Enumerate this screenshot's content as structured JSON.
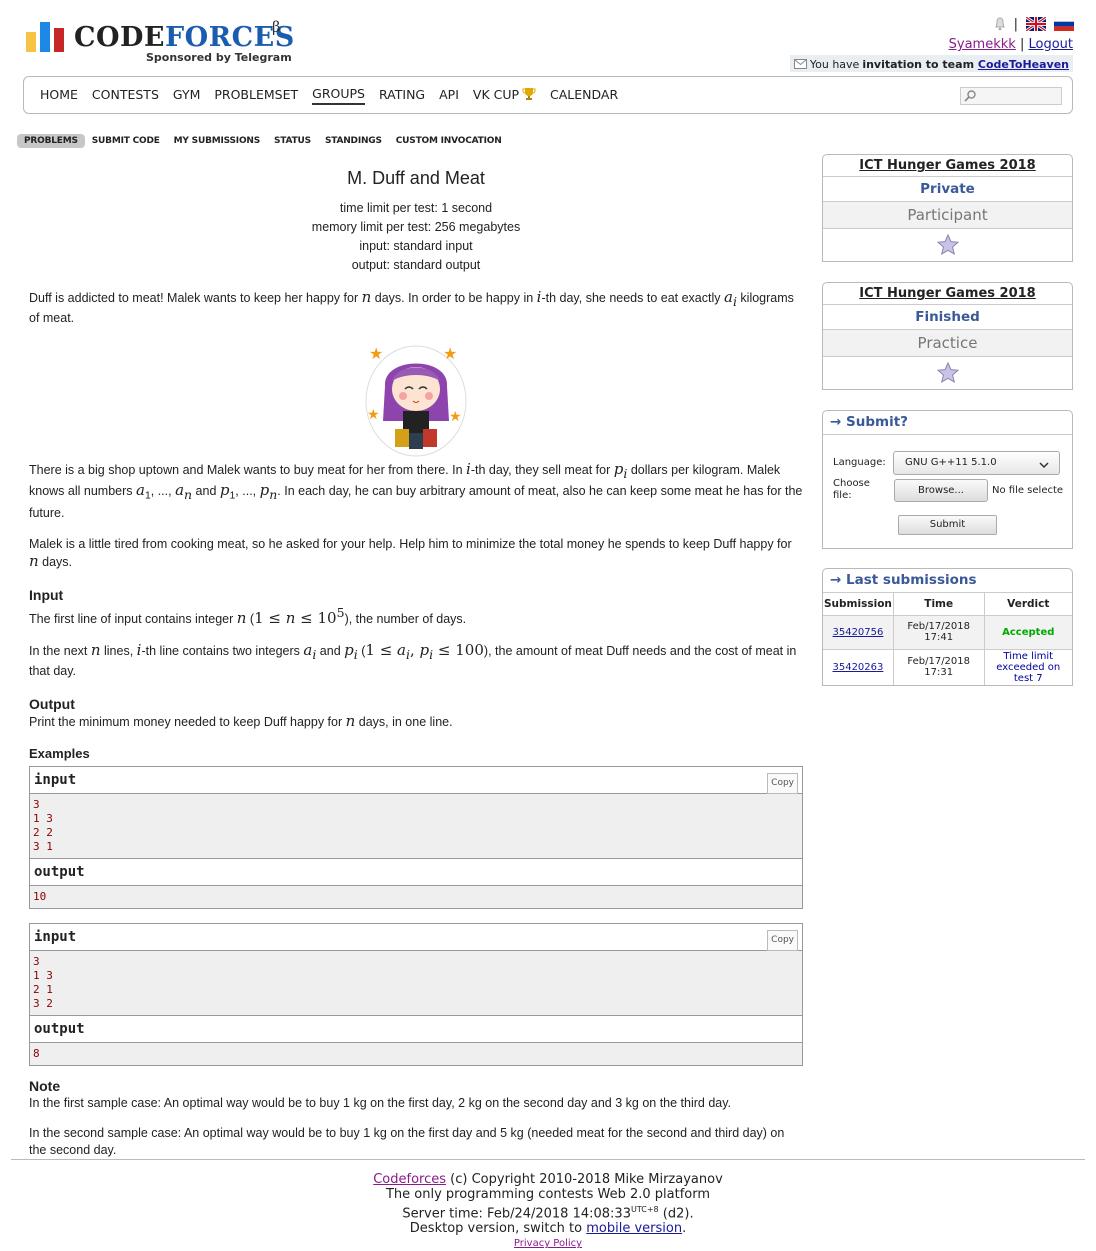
{
  "header": {
    "logo_text_1": "CODE",
    "logo_text_2": "FORCES",
    "logo_beta": "β",
    "sponsor": "Sponsored by Telegram",
    "user": "Syamekkk",
    "separator": "|",
    "logout": "Logout",
    "invite_prefix": "You have",
    "invite_bold": "invitation to team",
    "invite_team": "CodeToHeaven"
  },
  "menu": [
    "HOME",
    "CONTESTS",
    "GYM",
    "PROBLEMSET",
    "GROUPS",
    "RATING",
    "API",
    "VK CUP",
    "CALENDAR"
  ],
  "submenu": [
    "PROBLEMS",
    "SUBMIT CODE",
    "MY SUBMISSIONS",
    "STATUS",
    "STANDINGS",
    "CUSTOM INVOCATION"
  ],
  "problem": {
    "title": "M. Duff and Meat",
    "time_limit": "time limit per test: 1 second",
    "memory_limit": "memory limit per test: 256 megabytes",
    "input": "input: standard input",
    "output": "output: standard output",
    "input_title": "Input",
    "output_title": "Output",
    "examples_title": "Examples",
    "note_title": "Note",
    "note1": "In the first sample case: An optimal way would be to buy 1 kg on the first day, 2 kg on the second day and 3 kg on the third day.",
    "note2": "In the second sample case: An optimal way would be to buy 1 kg on the first day and 5 kg (needed meat for the second and third day) on the second day.",
    "samples": [
      {
        "input_label": "input",
        "copy": "Copy",
        "input": "3\n1 3\n2 2\n3 1",
        "output_label": "output",
        "output": "10"
      },
      {
        "input_label": "input",
        "copy": "Copy",
        "input": "3\n1 3\n2 1\n3 2",
        "output_label": "output",
        "output": "8"
      }
    ]
  },
  "sidebar": {
    "box1": {
      "title": "ICT Hunger Games 2018",
      "access": "Private",
      "role": "Participant"
    },
    "box2": {
      "title": "ICT Hunger Games 2018",
      "access": "Finished",
      "role": "Practice"
    },
    "submit": {
      "caption": "→ Submit?",
      "language_label": "Language:",
      "language_value": "GNU G++11 5.1.0",
      "file_label": "Choose file:",
      "browse": "Browse...",
      "no_file": "No file selected.",
      "submit": "Submit"
    },
    "last": {
      "caption": "→ Last submissions",
      "headers": [
        "Submission",
        "Time",
        "Verdict"
      ],
      "rows": [
        {
          "id": "35420756",
          "time": "Feb/17/2018 17:41",
          "verdict": "Accepted"
        },
        {
          "id": "35420263",
          "time": "Feb/17/2018 17:31",
          "verdict": "Time limit exceeded on test 7"
        }
      ]
    }
  },
  "footer": {
    "brand": "Codeforces",
    "copyright": " (c) Copyright 2010-2018 Mike Mirzayanov",
    "line2": "The only programming contests Web 2.0 platform",
    "server_time": "Server time: Feb/24/2018 14:08:33",
    "tz": "UTC+8",
    "d2": " (d2).",
    "desktop": "Desktop version, switch to ",
    "mobile": "mobile version",
    "period": ".",
    "privacy": "Privacy Policy"
  },
  "colors": {
    "accent": "#3b5998",
    "accepted": "#00a900",
    "tle": "#0000a0",
    "sample_text": "#8b0000"
  }
}
